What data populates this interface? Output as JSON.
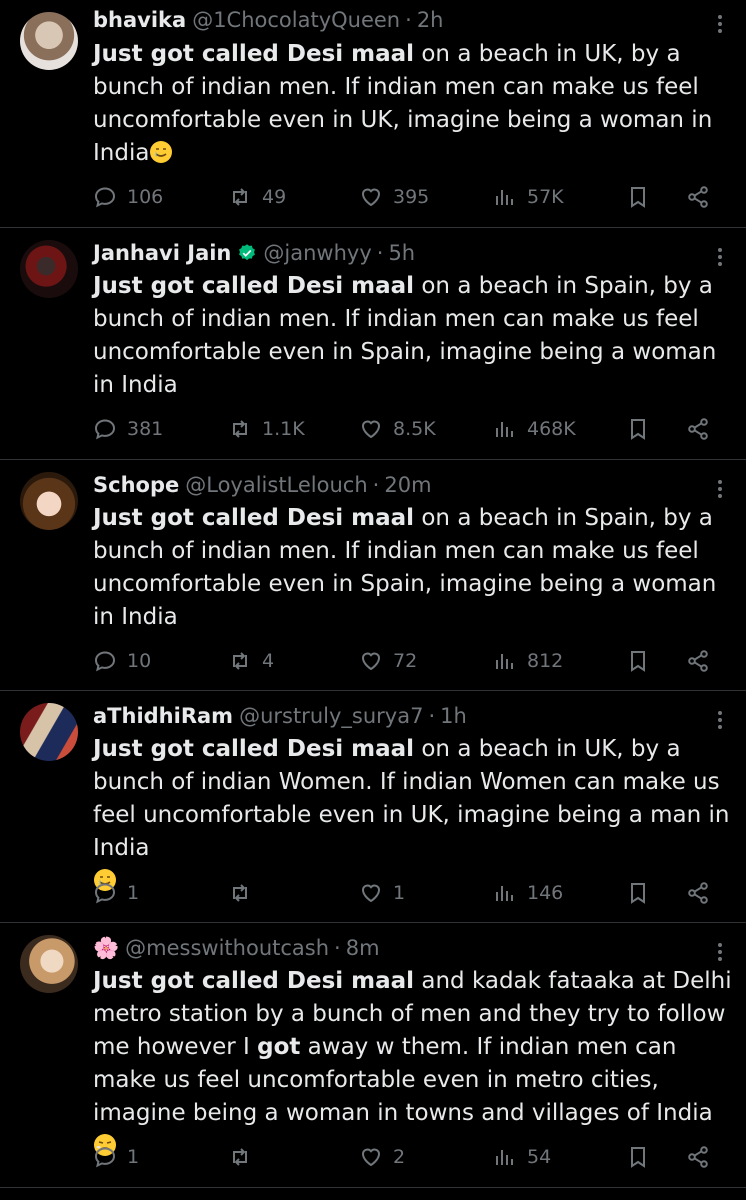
{
  "tweets": [
    {
      "name": "bhavika",
      "verified": false,
      "handle": "@1ChocolatyQueen",
      "dot": "·",
      "time": "2h",
      "text_bold": "Just got called Desi maal",
      "text_rest": " on a beach in UK, by a bunch of indian men. If indian men can make us feel uncomfortable even in UK, imagine being a woman in India",
      "emoji": "crying-smile",
      "replies": "106",
      "retweets": "49",
      "likes": "395",
      "views": "57K"
    },
    {
      "name": "Janhavi Jain",
      "verified": true,
      "handle": "@janwhyy",
      "dot": "·",
      "time": "5h",
      "text_bold": "Just got called Desi maal",
      "text_rest": " on a beach in Spain, by a bunch of indian men. If indian men can make us feel uncomfortable even in Spain, imagine being a woman in India",
      "emoji": "",
      "replies": "381",
      "retweets": "1.1K",
      "likes": "8.5K",
      "views": "468K"
    },
    {
      "name": "Schope",
      "verified": false,
      "handle": "@LoyalistLelouch",
      "dot": "·",
      "time": "20m",
      "text_bold": "Just got called Desi maal",
      "text_rest": " on a beach in Spain, by a bunch of indian men. If indian men can make us feel uncomfortable even in Spain, imagine being a woman in India",
      "emoji": "",
      "replies": "10",
      "retweets": "4",
      "likes": "72",
      "views": "812"
    },
    {
      "name": "aThidhiRam",
      "verified": false,
      "handle": "@urstruly_surya7",
      "dot": "·",
      "time": "1h",
      "text_bold": "Just got called Desi maal",
      "text_rest": " on a beach in UK, by a bunch of indian Women. If indian Women can make us feel uncomfortable even in UK, imagine being a man in India",
      "emoji": "crying-smile",
      "replies": "1",
      "retweets": "",
      "likes": "1",
      "views": "146"
    },
    {
      "name": "🌸",
      "verified": false,
      "handle": "@messwithoutcash",
      "dot": "·",
      "time": "8m",
      "text_bold": "Just got called Desi maal",
      "text_rest": " and kadak fataaka at Delhi metro station by a bunch of men and they try to follow me however I ",
      "text_bold2": "got",
      "text_rest2": " away w them. If indian men can make us feel uncomfortable even in metro cities, imagine being a woman in towns and villages of India",
      "emoji": "sad-face",
      "replies": "1",
      "retweets": "",
      "likes": "2",
      "views": "54"
    }
  ],
  "colors": {
    "background": "#000000",
    "text": "#e7e9ea",
    "muted": "#71767b",
    "divider": "#2f3336",
    "verified": "#00ba7c"
  }
}
